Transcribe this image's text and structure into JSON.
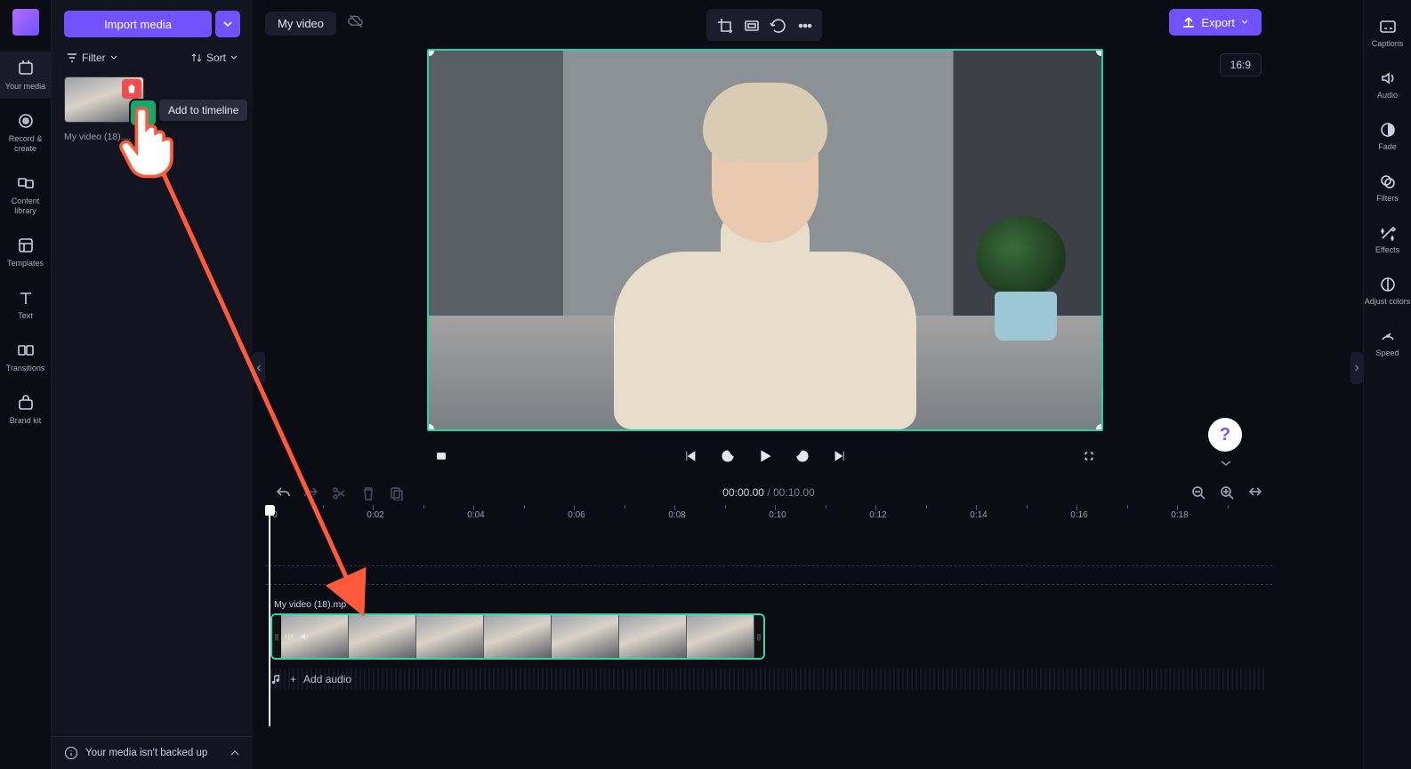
{
  "app": {
    "title": "My video"
  },
  "left_rail": {
    "items": [
      {
        "label": "Your media"
      },
      {
        "label": "Record &\ncreate"
      },
      {
        "label": "Content\nlibrary"
      },
      {
        "label": "Templates"
      },
      {
        "label": "Text"
      },
      {
        "label": "Transitions"
      },
      {
        "label": "Brand kit"
      }
    ]
  },
  "media_panel": {
    "import_label": "Import media",
    "filter_label": "Filter",
    "sort_label": "Sort",
    "thumb_name": "My video (18)....",
    "tooltip": "Add to timeline",
    "backup_msg": "Your media isn't backed up"
  },
  "right_rail": {
    "items": [
      {
        "label": "Captions"
      },
      {
        "label": "Audio"
      },
      {
        "label": "Fade"
      },
      {
        "label": "Filters"
      },
      {
        "label": "Effects"
      },
      {
        "label": "Adjust\ncolors"
      },
      {
        "label": "Speed"
      }
    ]
  },
  "topbar": {
    "export_label": "Export",
    "aspect_ratio": "16:9"
  },
  "playback": {
    "current": "00:00.00",
    "sep": " / ",
    "duration": "00:10.00"
  },
  "ruler": {
    "labels": [
      "0",
      "0:02",
      "0:04",
      "0:06",
      "0:08",
      "0:10",
      "0:12",
      "0:14",
      "0:16",
      "0:18"
    ]
  },
  "timeline": {
    "clip_name": "My video (18).mp",
    "add_audio": "Add audio"
  }
}
